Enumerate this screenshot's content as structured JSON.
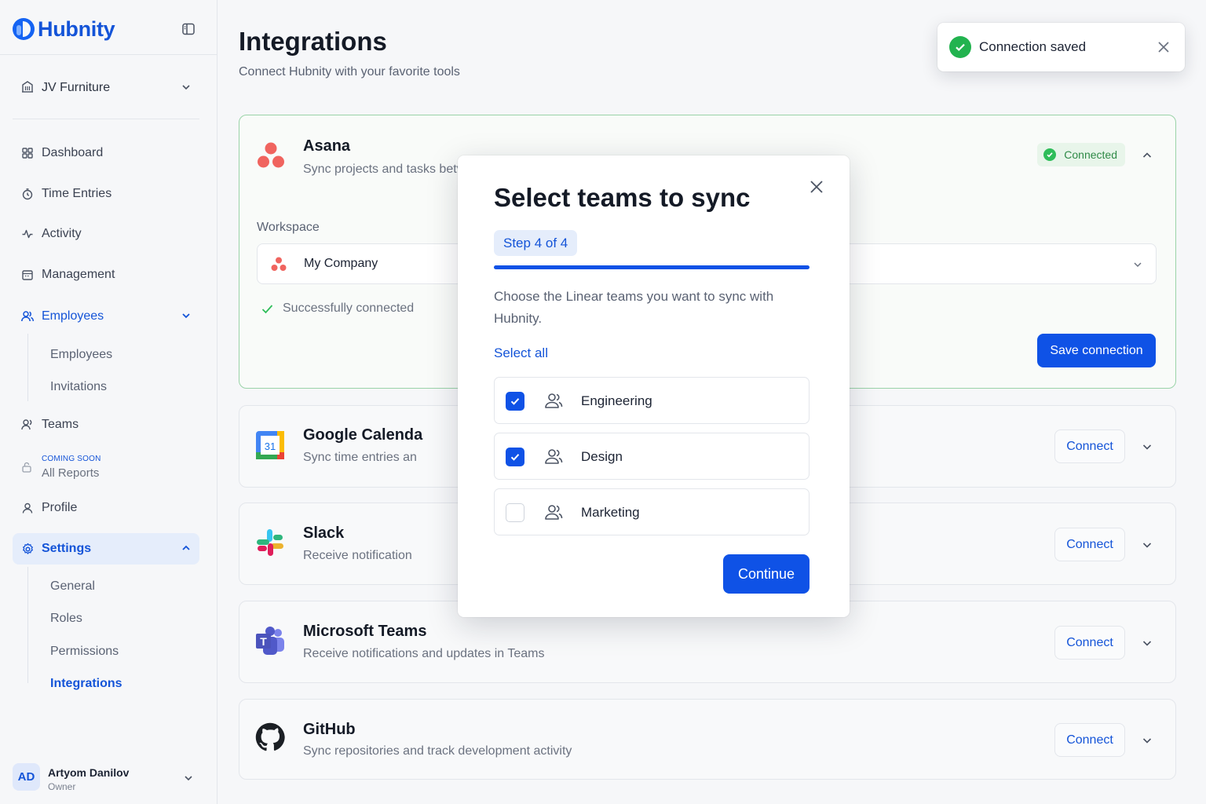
{
  "app": {
    "brand": "Hubnity",
    "accent": "#0f52e6"
  },
  "sidebar": {
    "company": "JV Furniture",
    "nav": {
      "dashboard": "Dashboard",
      "time_entries": "Time Entries",
      "activity": "Activity",
      "management": "Management",
      "employees": "Employees",
      "teams": "Teams",
      "profile": "Profile",
      "settings": "Settings"
    },
    "employees_sub": [
      "Employees",
      "Invitations"
    ],
    "all_reports": {
      "tag": "COMING SOON",
      "label": "All Reports"
    },
    "settings_sub": [
      "General",
      "Roles",
      "Permissions",
      "Integrations"
    ],
    "user": {
      "initials": "AD",
      "name": "Artyom Danilov",
      "role": "Owner"
    }
  },
  "header": {
    "title": "Integrations",
    "subtitle": "Connect Hubnity with your favorite tools"
  },
  "integrations": {
    "asana": {
      "name": "Asana",
      "desc": "Sync projects and tasks betv",
      "status": "Connected",
      "workspace_label": "Workspace",
      "workspace_value": "My Company",
      "success": "Successfully connected",
      "save": "Save connection"
    },
    "gcal": {
      "name": "Google Calenda",
      "desc": "Sync time entries an",
      "action": "Connect",
      "icon_text": "31"
    },
    "slack": {
      "name": "Slack",
      "desc": "Receive notification",
      "action": "Connect"
    },
    "msteams": {
      "name": "Microsoft Teams",
      "desc": "Receive notifications and updates in Teams",
      "action": "Connect",
      "icon_text": "T"
    },
    "github": {
      "name": "GitHub",
      "desc": "Sync repositories and track development activity",
      "action": "Connect"
    }
  },
  "modal": {
    "title": "Select teams to sync",
    "step": "Step 4 of 4",
    "progress": 1.0,
    "description": "Choose the Linear teams you want to sync with Hubnity.",
    "select_all": "Select all",
    "teams": [
      {
        "name": "Engineering",
        "checked": true
      },
      {
        "name": "Design",
        "checked": true
      },
      {
        "name": "Marketing",
        "checked": false
      }
    ],
    "continue": "Continue"
  },
  "toast": {
    "message": "Connection saved"
  }
}
